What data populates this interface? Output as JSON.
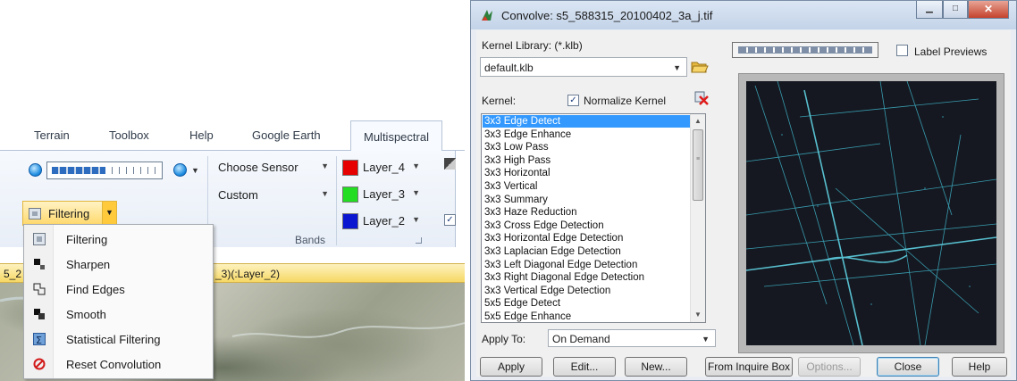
{
  "ribbon": {
    "tabs": [
      {
        "label": "Terrain"
      },
      {
        "label": "Toolbox"
      },
      {
        "label": "Help"
      },
      {
        "label": "Google Earth"
      },
      {
        "label": "Multispectral",
        "active": true
      }
    ],
    "filter_button_label": "Filtering",
    "sensor_combo": {
      "value": "Choose Sensor"
    },
    "custom_combo": {
      "value": "Custom"
    },
    "bands": [
      {
        "label": "Layer_4",
        "color": "#e60000"
      },
      {
        "label": "Layer_3",
        "color": "#22dd22"
      },
      {
        "label": "Layer_2",
        "color": "#0a16d0"
      }
    ],
    "bands_group_label": "Bands",
    "map_title_fragment_left": "5_2",
    "map_title_fragment_right": "_3)(:Layer_2)"
  },
  "filter_menu": {
    "items": [
      {
        "label": "Filtering",
        "icon": "filter-icon"
      },
      {
        "label": "Sharpen",
        "icon": "sharpen-icon"
      },
      {
        "label": "Find Edges",
        "icon": "find-edges-icon"
      },
      {
        "label": "Smooth",
        "icon": "smooth-icon"
      },
      {
        "label": "Statistical Filtering",
        "icon": "statistical-filter-icon"
      },
      {
        "label": "Reset Convolution",
        "icon": "reset-icon"
      }
    ]
  },
  "dialog": {
    "title": "Convolve: s5_588315_20100402_3a_j.tif",
    "kernel_library_label": "Kernel Library: (*.klb)",
    "kernel_library_value": "default.klb",
    "kernel_label": "Kernel:",
    "normalize_label": "Normalize Kernel",
    "normalize_checked": true,
    "label_previews_label": "Label Previews",
    "label_previews_checked": false,
    "kernels": [
      "3x3 Edge Detect",
      "3x3 Edge Enhance",
      "3x3 Low Pass",
      "3x3 High Pass",
      "3x3 Horizontal",
      "3x3 Vertical",
      "3x3 Summary",
      "3x3 Haze Reduction",
      "3x3 Cross Edge Detection",
      "3x3 Horizontal Edge Detection",
      "3x3 Laplacian Edge Detection",
      "3x3 Left Diagonal Edge Detection",
      "3x3 Right Diagonal Edge Detection",
      "3x3 Vertical Edge Detection",
      "5x5 Edge Detect",
      "5x5 Edge Enhance"
    ],
    "selected_kernel_index": 0,
    "apply_to_label": "Apply To:",
    "apply_to_value": "On Demand",
    "buttons": {
      "apply": "Apply",
      "edit": "Edit...",
      "new": "New...",
      "from_inquire": "From Inquire Box",
      "options": "Options...",
      "close": "Close",
      "help": "Help"
    }
  }
}
